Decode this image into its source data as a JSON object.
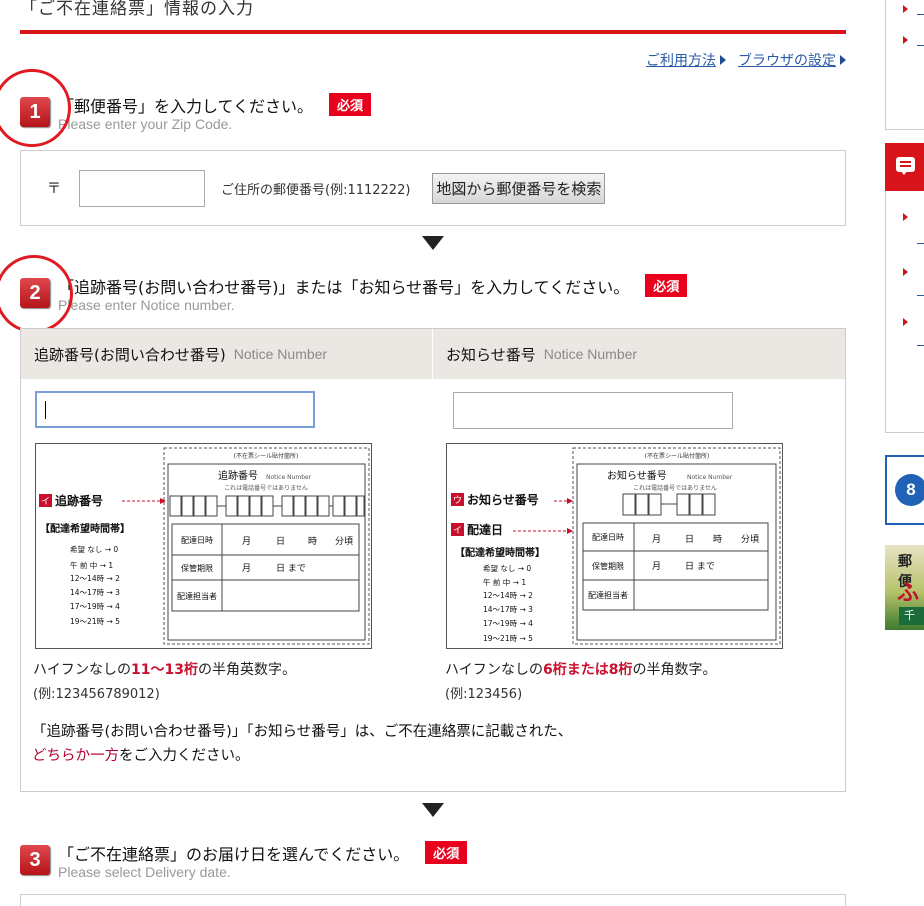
{
  "page": {
    "title": "「ご不在連絡票」情報の入力",
    "help_links": [
      "ご利用方法",
      "ブラウザの設定"
    ]
  },
  "step1": {
    "number": "1",
    "heading": "「郵便番号」を入力してください。",
    "required": "必須",
    "sub": "Please enter your Zip Code.",
    "zip_mark": "〒",
    "zip_value": "",
    "zip_note": "ご住所の郵便番号(例:1112222)",
    "map_button": "地図から郵便番号を検索"
  },
  "step2": {
    "number": "2",
    "heading": "「追跡番号(お問い合わせ番号)」または「お知らせ番号」を入力してください。",
    "required": "必須",
    "sub": "Please enter Notice  number.",
    "col_left": {
      "label": "追跡番号(お問い合わせ番号)",
      "en": "Notice Number",
      "value": ""
    },
    "col_right": {
      "label": "お知らせ番号",
      "en": "Notice Number",
      "value": ""
    },
    "slip_left": {
      "top_label": "(不在票シール貼付箇所)",
      "box_title": "追跡番号",
      "box_title_en": "Notice Number",
      "box_note": "これは電話番号ではありません",
      "marker_a": "イ",
      "marker_a_text": "追跡番号",
      "times_head": "【配達希望時間帯】",
      "times": [
        "希望 なし → 0",
        "午 前 中 → 1",
        "12～14時 → 2",
        "14～17時 → 3",
        "17～19時 → 4",
        "19～21時 → 5"
      ],
      "rows": [
        "配達日時",
        "保管期限",
        "配達担当者"
      ],
      "date_cells": [
        "月",
        "日",
        "時",
        "分頃"
      ],
      "until_cells": [
        "月",
        "日 まで"
      ]
    },
    "slip_right": {
      "top_label": "(不在票シール貼付箇所)",
      "box_title": "お知らせ番号",
      "box_title_en": "Notice Number",
      "box_note": "これは電話番号ではありません",
      "marker_a": "ウ",
      "marker_a_text": "お知らせ番号",
      "marker_b": "イ",
      "marker_b_text": "配達日",
      "times_head": "【配達希望時間帯】",
      "times": [
        "希望 なし → 0",
        "午 前 中 → 1",
        "12～14時 → 2",
        "14～17時 → 3",
        "17～19時 → 4",
        "19～21時 → 5"
      ],
      "rows": [
        "配達日時",
        "保管期限",
        "配達担当者"
      ],
      "date_cells": [
        "月",
        "日",
        "時",
        "分頃"
      ],
      "until_cells": [
        "月",
        "日 まで"
      ]
    },
    "desc_left": {
      "pre": "ハイフンなしの",
      "red": "11～13桁",
      "post": "の半角英数字。"
    },
    "example_left": "(例:123456789012)",
    "desc_right": {
      "pre": "ハイフンなしの",
      "red": "6桁または8桁",
      "post": "の半角数字。"
    },
    "example_right": "(例:123456)",
    "note_line1": "「追跡番号(お問い合わせ番号)」「お知らせ番号」は、ご不在連絡票に記載された、",
    "note_red": "どちらか一方",
    "note_line2_post": "をご入力ください。"
  },
  "step3": {
    "number": "3",
    "heading": "「ご不在連絡票」のお届け日を選んでください。",
    "required": "必須",
    "sub": "Please select Delivery date."
  },
  "sidebar": {
    "banner_text_1": "郵便",
    "banner_text_2": "ふ",
    "banner_text_3": "千"
  },
  "colors": {
    "accent": "#d7141a",
    "link": "#2a5aa8",
    "annotation_circle": "#e01a22"
  }
}
